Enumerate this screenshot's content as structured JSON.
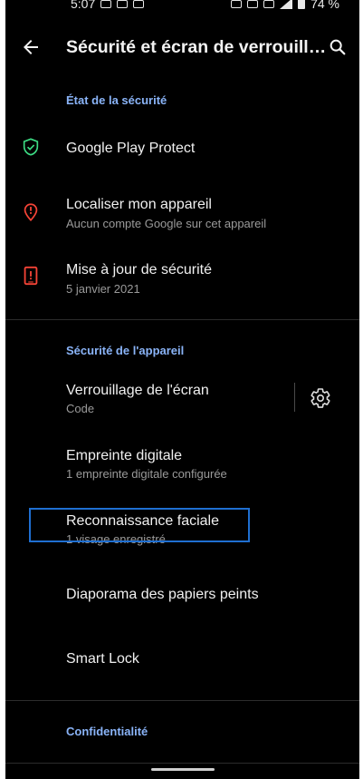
{
  "status_bar": {
    "time": "5:07",
    "battery": "74 %"
  },
  "app_bar": {
    "title": "Sécurité et écran de verrouill…"
  },
  "sections": {
    "security_state": "État de la sécurité",
    "device_security": "Sécurité de l'appareil",
    "privacy": "Confidentialité"
  },
  "items": {
    "play_protect": {
      "title": "Google Play Protect"
    },
    "find_device": {
      "title": "Localiser mon appareil",
      "subtitle": "Aucun compte Google sur cet appareil"
    },
    "security_update": {
      "title": "Mise à jour de sécurité",
      "subtitle": "5 janvier 2021"
    },
    "screen_lock": {
      "title": "Verrouillage de l'écran",
      "subtitle": "Code"
    },
    "fingerprint": {
      "title": "Empreinte digitale",
      "subtitle": "1 empreinte digitale configurée"
    },
    "face_unlock": {
      "title": "Reconnaissance faciale",
      "subtitle": "1 visage enregistré"
    },
    "wallpaper_slideshow": {
      "title": "Diaporama des papiers peints"
    },
    "smart_lock": {
      "title": "Smart Lock"
    }
  },
  "colors": {
    "accent": "#8ab4f8",
    "shield_green": "#3ddc84",
    "alert_red": "#f44336",
    "focus_blue": "#1f6fd1"
  },
  "icons": {
    "back": "arrow-left-icon",
    "search": "search-icon",
    "play_protect": "shield-check-icon",
    "find_device": "location-pin-alert-icon",
    "security_update": "phone-alert-icon",
    "screen_lock_settings": "gear-icon"
  }
}
